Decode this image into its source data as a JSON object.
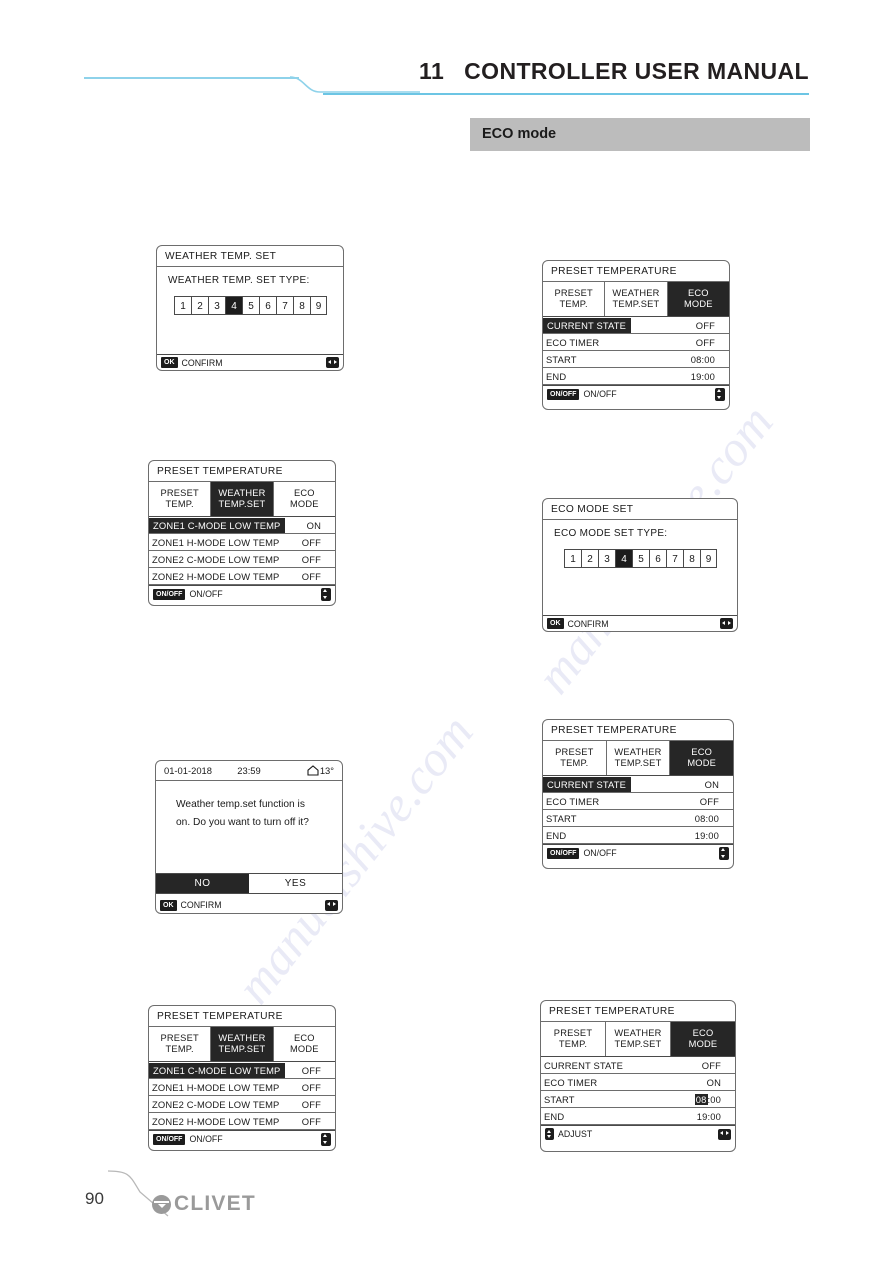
{
  "header": {
    "chapter_number": "11",
    "title": "CONTROLLER USER MANUAL",
    "section_label": "ECO mode"
  },
  "footer": {
    "page_number": "90",
    "brand": "CLIVET"
  },
  "watermark": "manualshive.com",
  "panels": {
    "weather_temp_set": {
      "title": "WEATHER   TEMP. SET",
      "subtitle": "WEATHER   TEMP. SET TYPE:",
      "numbers": [
        "1",
        "2",
        "3",
        "4",
        "5",
        "6",
        "7",
        "8",
        "9"
      ],
      "selected_number": "4",
      "footer_key": "OK",
      "footer_label": "CONFIRM",
      "footer_icon": "left-right-arrows-icon"
    },
    "preset_weather_zones_on": {
      "title": "PRESET TEMPERATURE",
      "tabs": [
        {
          "line1": "PRESET",
          "line2": "TEMP.",
          "selected": false
        },
        {
          "line1": "WEATHER",
          "line2": "TEMP.SET",
          "selected": true
        },
        {
          "line1": "ECO",
          "line2": "MODE",
          "selected": false
        }
      ],
      "rows": [
        {
          "label": "ZONE1 C-MODE LOW TEMP",
          "value": "ON",
          "highlighted": true
        },
        {
          "label": "ZONE1 H-MODE LOW TEMP",
          "value": "OFF",
          "highlighted": false
        },
        {
          "label": "ZONE2 C-MODE LOW TEMP",
          "value": "OFF",
          "highlighted": false
        },
        {
          "label": "ZONE2 H-MODE LOW TEMP",
          "value": "OFF",
          "highlighted": false
        }
      ],
      "footer_key": "ON/OFF",
      "footer_label": "ON/OFF",
      "footer_icon": "up-down-arrows-icon"
    },
    "confirm_dialog": {
      "date": "01-01-2018",
      "time": "23:59",
      "outdoor_temp": "13°",
      "temp_icon": "house-icon",
      "message_line1": "Weather temp.set function is",
      "message_line2": "on. Do you want to turn off it?",
      "buttons": [
        {
          "label": "NO",
          "selected": true
        },
        {
          "label": "YES",
          "selected": false
        }
      ],
      "footer_key": "OK",
      "footer_label": "CONFIRM",
      "footer_icon": "left-right-arrows-icon"
    },
    "preset_weather_zones_off": {
      "title": "PRESET TEMPERATURE",
      "tabs": [
        {
          "line1": "PRESET",
          "line2": "TEMP.",
          "selected": false
        },
        {
          "line1": "WEATHER",
          "line2": "TEMP.SET",
          "selected": true
        },
        {
          "line1": "ECO",
          "line2": "MODE",
          "selected": false
        }
      ],
      "rows": [
        {
          "label": "ZONE1 C-MODE LOW TEMP",
          "value": "OFF",
          "highlighted": true
        },
        {
          "label": "ZONE1 H-MODE LOW TEMP",
          "value": "OFF",
          "highlighted": false
        },
        {
          "label": "ZONE2 C-MODE LOW TEMP",
          "value": "OFF",
          "highlighted": false
        },
        {
          "label": "ZONE2 H-MODE LOW TEMP",
          "value": "OFF",
          "highlighted": false
        }
      ],
      "footer_key": "ON/OFF",
      "footer_label": "ON/OFF",
      "footer_icon": "up-down-arrows-icon"
    },
    "eco_state_off": {
      "title": "PRESET TEMPERATURE",
      "tabs": [
        {
          "line1": "PRESET",
          "line2": "TEMP.",
          "selected": false
        },
        {
          "line1": "WEATHER",
          "line2": "TEMP.SET",
          "selected": false
        },
        {
          "line1": "ECO",
          "line2": "MODE",
          "selected": true
        }
      ],
      "rows": [
        {
          "label": "CURRENT STATE",
          "value": "OFF",
          "highlighted": true
        },
        {
          "label": "ECO  TIMER",
          "value": "OFF",
          "highlighted": false
        },
        {
          "label": "START",
          "value": "08:00",
          "highlighted": false
        },
        {
          "label": "END",
          "value": "19:00",
          "highlighted": false
        }
      ],
      "footer_key": "ON/OFF",
      "footer_label": "ON/OFF",
      "footer_icon": "up-down-arrows-icon"
    },
    "eco_mode_set": {
      "title": "ECO    MODE SET",
      "subtitle": "ECO MODE SET  TYPE:",
      "numbers": [
        "1",
        "2",
        "3",
        "4",
        "5",
        "6",
        "7",
        "8",
        "9"
      ],
      "selected_number": "4",
      "footer_key": "OK",
      "footer_label": "CONFIRM",
      "footer_icon": "left-right-arrows-icon"
    },
    "eco_state_on": {
      "title": "PRESET TEMPERATURE",
      "tabs": [
        {
          "line1": "PRESET",
          "line2": "TEMP.",
          "selected": false
        },
        {
          "line1": "WEATHER",
          "line2": "TEMP.SET",
          "selected": false
        },
        {
          "line1": "ECO",
          "line2": "MODE",
          "selected": true
        }
      ],
      "rows": [
        {
          "label": "CURRENT STATE",
          "value": "ON",
          "highlighted": true
        },
        {
          "label": "ECO  TIMER",
          "value": "OFF",
          "highlighted": false
        },
        {
          "label": "START",
          "value": "08:00",
          "highlighted": false
        },
        {
          "label": "END",
          "value": "19:00",
          "highlighted": false
        }
      ],
      "footer_key": "ON/OFF",
      "footer_label": "ON/OFF",
      "footer_icon": "up-down-arrows-icon"
    },
    "eco_timer_adjust": {
      "title": "PRESET TEMPERATURE",
      "tabs": [
        {
          "line1": "PRESET",
          "line2": "TEMP.",
          "selected": false
        },
        {
          "line1": "WEATHER",
          "line2": "TEMP.SET",
          "selected": false
        },
        {
          "line1": "ECO",
          "line2": "MODE",
          "selected": true
        }
      ],
      "rows": [
        {
          "label": "CURRENT STATE",
          "value": "OFF",
          "highlighted": false
        },
        {
          "label": "ECO  TIMER",
          "value": "ON",
          "highlighted": false
        },
        {
          "label": "START",
          "value": "08:00",
          "highlighted": false,
          "value_hl_prefix": "08",
          "value_rest": ":00"
        },
        {
          "label": "END",
          "value": "19:00",
          "highlighted": false
        }
      ],
      "footer_label": "ADJUST",
      "footer_key_icon": "up-down-arrows-icon",
      "footer_icon": "left-right-arrows-icon"
    }
  },
  "colors": {
    "accent_rule": "#6cc5e4",
    "band": "#bcbcbc",
    "lcd_border": "#6d6d6d",
    "highlight": "#262626",
    "brand_gray": "#9a9a9a"
  }
}
